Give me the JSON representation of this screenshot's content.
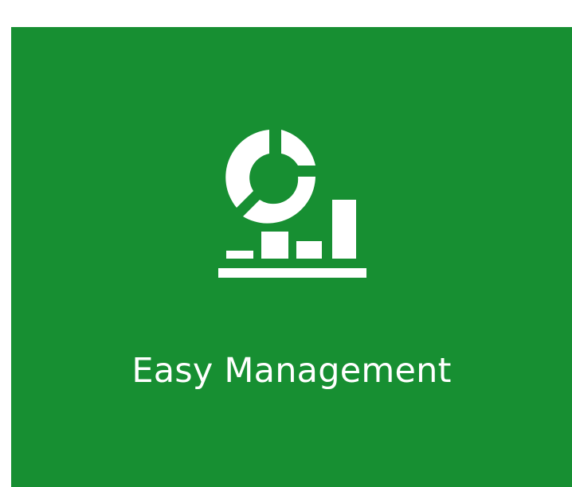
{
  "feature": {
    "title": "Easy Management",
    "icon": "analytics-chart-icon",
    "background_color": "#178f32",
    "foreground_color": "#ffffff"
  }
}
